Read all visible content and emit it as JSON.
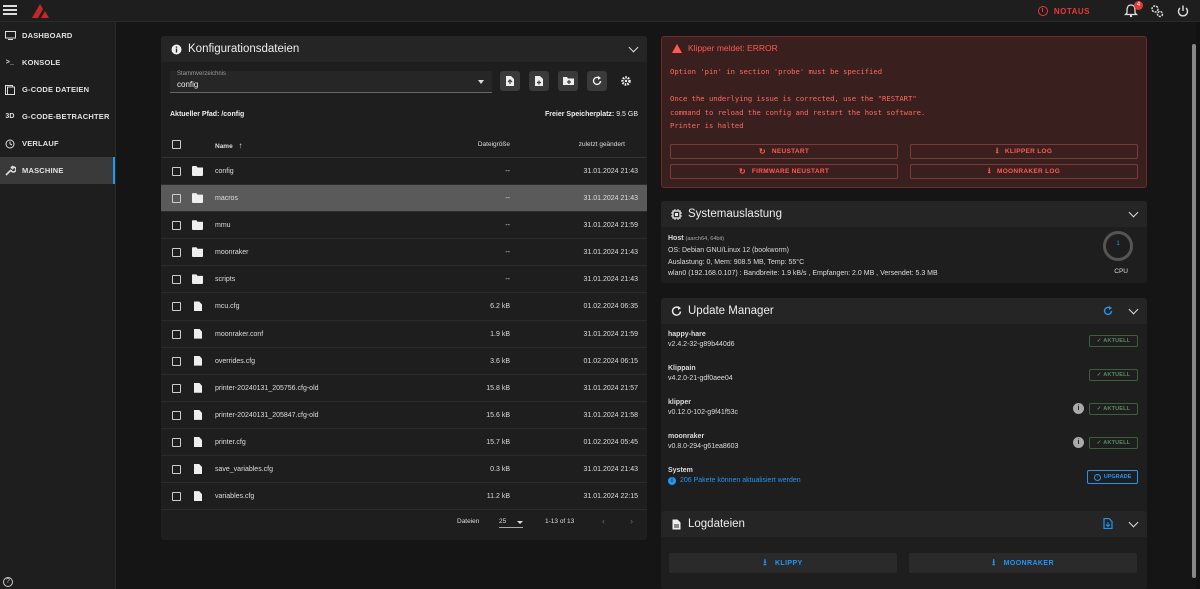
{
  "topbar": {
    "notaus_label": "NOTAUS",
    "notification_count": "4",
    "colors": {
      "accent": "#2196f3",
      "error": "#e53935"
    }
  },
  "sidebar": {
    "items": [
      {
        "label": "DASHBOARD",
        "icon": "monitor-icon"
      },
      {
        "label": "KONSOLE",
        "icon": "console-icon"
      },
      {
        "label": "G-CODE DATEIEN",
        "icon": "file-icon"
      },
      {
        "label": "G-CODE-BETRACHTER",
        "icon": "3d-icon",
        "glyph": "3D"
      },
      {
        "label": "VERLAUF",
        "icon": "history-icon"
      },
      {
        "label": "MASCHINE",
        "icon": "wrench-icon"
      }
    ],
    "help": "?"
  },
  "files": {
    "title": "Konfigurationsdateien",
    "root_label": "Stammverzeichnis",
    "root_value": "config",
    "current_path_label": "Aktueller Pfad: /config",
    "free_label": "Freier Speicherplatz:",
    "free_value": "9.5 GB",
    "col_name": "Name",
    "col_size": "Dateigröße",
    "col_modified": "zuletzt geändert",
    "rows": [
      {
        "type": "folder",
        "name": "config",
        "size": "--",
        "date": "31.01.2024 21:43"
      },
      {
        "type": "folder",
        "name": "macros",
        "size": "--",
        "date": "31.01.2024 21:43",
        "selected": true
      },
      {
        "type": "folder",
        "name": "mmu",
        "size": "--",
        "date": "31.01.2024 21:59"
      },
      {
        "type": "folder",
        "name": "moonraker",
        "size": "--",
        "date": "31.01.2024 21:43"
      },
      {
        "type": "folder",
        "name": "scripts",
        "size": "--",
        "date": "31.01.2024 21:43"
      },
      {
        "type": "file",
        "name": "mcu.cfg",
        "size": "6.2 kB",
        "date": "01.02.2024 06:35"
      },
      {
        "type": "file",
        "name": "moonraker.conf",
        "size": "1.9 kB",
        "date": "31.01.2024 21:59"
      },
      {
        "type": "file",
        "name": "overrides.cfg",
        "size": "3.6 kB",
        "date": "01.02.2024 06:15"
      },
      {
        "type": "file",
        "name": "printer-20240131_205756.cfg-old",
        "size": "15.8 kB",
        "date": "31.01.2024 21:57"
      },
      {
        "type": "file",
        "name": "printer-20240131_205847.cfg-old",
        "size": "15.6 kB",
        "date": "31.01.2024 21:58"
      },
      {
        "type": "file",
        "name": "printer.cfg",
        "size": "15.7 kB",
        "date": "01.02.2024 05:45"
      },
      {
        "type": "file",
        "name": "save_variables.cfg",
        "size": "0.3 kB",
        "date": "31.01.2024 21:43"
      },
      {
        "type": "file",
        "name": "variables.cfg",
        "size": "11.2 kB",
        "date": "31.01.2024 22:15"
      }
    ],
    "pager": {
      "label": "Dateien",
      "per_page": "25",
      "range": "1-13 of 13"
    }
  },
  "error": {
    "title": "Klipper meldet: ERROR",
    "message": "Option 'pin' in section 'probe' must be specified\n\nOnce the underlying issue is corrected, use the \"RESTART\"\ncommand to reload the config and restart the host software.\nPrinter is halted",
    "buttons": {
      "restart": "NEUSTART",
      "klipper_log": "KLIPPER LOG",
      "fw_restart": "FIRMWARE NEUSTART",
      "moonraker_log": "MOONRAKER LOG"
    }
  },
  "system": {
    "title": "Systemauslastung",
    "host_label": "Host",
    "host_arch": "(aarch64, 64bit)",
    "os": "OS: Debian GNU/Linux 12 (bookworm)",
    "load": "Auslastung: 0, Mem: 908.5 MB, Temp: 55°C",
    "net": "wlan0 (192.168.0.107) : Bandbreite: 1.9 kB/s , Empfangen: 2.0 MB , Versendet: 5.3 MB",
    "cpu_value": "1",
    "cpu_label": "CPU"
  },
  "updates": {
    "title": "Update Manager",
    "items": [
      {
        "name": "happy-hare",
        "version": "v2.4.2-32-g89b440d6",
        "status": "AKTUELL"
      },
      {
        "name": "Klippain",
        "version": "v4.2.0-21-gdf0aee04",
        "status": "AKTUELL"
      },
      {
        "name": "klipper",
        "version": "v0.12.0-102-g9f41f53c",
        "status": "AKTUELL"
      },
      {
        "name": "moonraker",
        "version": "v0.8.0-294-g61ea8603",
        "status": "AKTUELL"
      }
    ],
    "system_label": "System",
    "system_packages": "206 Pakete können aktualisiert werden",
    "upgrade_label": "UPGRADE"
  },
  "logs": {
    "title": "Logdateien",
    "klippy": "KLIPPY",
    "moonraker": "MOONRAKER"
  }
}
